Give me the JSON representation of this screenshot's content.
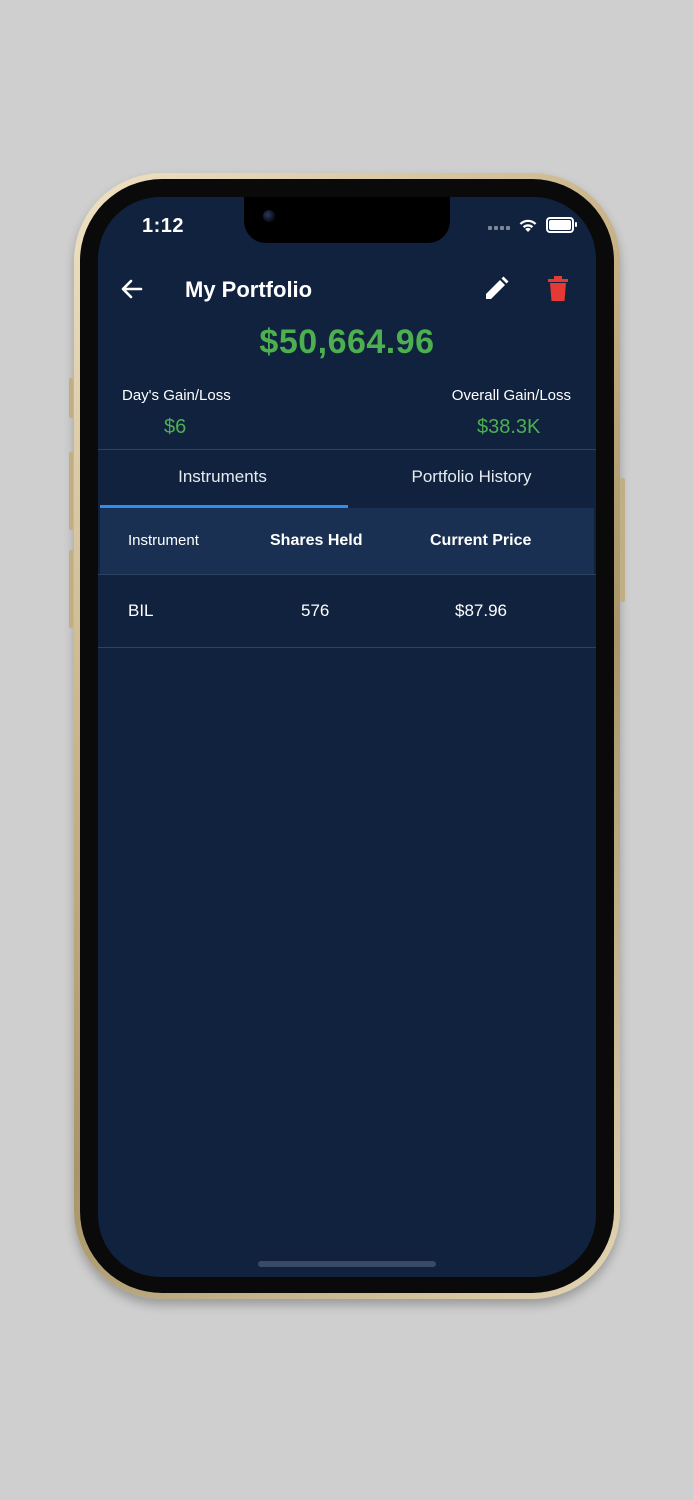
{
  "status_bar": {
    "time": "1:12"
  },
  "app_bar": {
    "title": "My Portfolio",
    "back_icon": "arrow-left-icon",
    "edit_icon": "pencil-icon",
    "delete_icon": "trash-icon"
  },
  "summary": {
    "total_value": "$50,664.96",
    "days_gain_label": "Day's Gain/Loss",
    "days_gain_value": "$6",
    "overall_gain_label": "Overall Gain/Loss",
    "overall_gain_value": "$38.3K"
  },
  "tabs": [
    {
      "label": "Instruments",
      "active": true
    },
    {
      "label": "Portfolio History",
      "active": false
    }
  ],
  "table": {
    "columns": [
      "Instrument",
      "Shares Held",
      "Current Price"
    ],
    "rows": [
      {
        "instrument": "BIL",
        "shares": "576",
        "price": "$87.96"
      }
    ]
  },
  "colors": {
    "background": "#10223d",
    "header_row": "#1a3052",
    "positive": "#4caf50",
    "delete": "#e53935",
    "tab_indicator": "#2f8cf0"
  }
}
